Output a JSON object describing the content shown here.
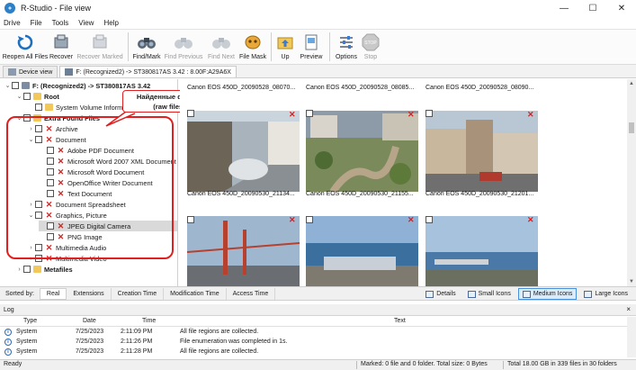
{
  "window": {
    "title": "R-Studio - File view"
  },
  "menu": [
    "Drive",
    "File",
    "Tools",
    "View",
    "Help"
  ],
  "toolbar": {
    "buttons": [
      {
        "label": "Reopen All Files",
        "icon": "reopen-icon",
        "enabled": true
      },
      {
        "label": "Recover",
        "icon": "recover-icon",
        "enabled": true
      },
      {
        "label": "Recover Marked",
        "icon": "recover-marked-icon",
        "enabled": false
      },
      {
        "label": "Find/Mark",
        "icon": "binoculars-icon",
        "enabled": true
      },
      {
        "label": "Find Previous",
        "icon": "find-previous-icon",
        "enabled": false
      },
      {
        "label": "Find Next",
        "icon": "find-next-icon",
        "enabled": false
      },
      {
        "label": "File Mask",
        "icon": "file-mask-icon",
        "enabled": true
      },
      {
        "label": "Up",
        "icon": "folder-up-icon",
        "enabled": true
      },
      {
        "label": "Preview",
        "icon": "preview-icon",
        "enabled": true
      },
      {
        "label": "Options",
        "icon": "options-icon",
        "enabled": true
      },
      {
        "label": "Stop",
        "icon": "stop-icon",
        "enabled": false
      }
    ]
  },
  "tabs": [
    {
      "label": "Device view"
    },
    {
      "label": "F: (Recognized2) -> ST380817AS 3.42 : 8.00F:A29A6X"
    }
  ],
  "tree": {
    "items": [
      {
        "label": "F: (Recognized2) -> ST380817AS 3.42",
        "bold": true,
        "icon": "drive-icon",
        "expander": "v"
      },
      {
        "label": "Root",
        "bold": true,
        "icon": "folder-icon",
        "expander": "v"
      },
      {
        "label": "System Volume Information",
        "bold": false,
        "icon": "folder-icon",
        "expander": ""
      },
      {
        "label": "Extra Found Files",
        "bold": true,
        "icon": "folder-icon",
        "expander": "v"
      },
      {
        "label": "Archive",
        "bold": false,
        "icon": "deleted-icon",
        "expander": ">"
      },
      {
        "label": "Document",
        "bold": false,
        "icon": "deleted-icon",
        "expander": "v"
      },
      {
        "label": "Adobe PDF Document",
        "bold": false,
        "icon": "deleted-icon",
        "expander": ""
      },
      {
        "label": "Microsoft Word 2007 XML Document",
        "bold": false,
        "icon": "deleted-icon",
        "expander": ""
      },
      {
        "label": "Microsoft Word Document",
        "bold": false,
        "icon": "deleted-icon",
        "expander": ""
      },
      {
        "label": "OpenOffice Writer Document",
        "bold": false,
        "icon": "deleted-icon",
        "expander": ""
      },
      {
        "label": "Text Document",
        "bold": false,
        "icon": "deleted-icon",
        "expander": ""
      },
      {
        "label": "Document Spreadsheet",
        "bold": false,
        "icon": "deleted-icon",
        "expander": ">"
      },
      {
        "label": "Graphics, Picture",
        "bold": false,
        "icon": "deleted-icon",
        "expander": "v"
      },
      {
        "label": "JPEG Digital Camera",
        "bold": false,
        "icon": "deleted-icon",
        "expander": ""
      },
      {
        "label": "PNG Image",
        "bold": false,
        "icon": "deleted-icon",
        "expander": ""
      },
      {
        "label": "Multimedia Audio",
        "bold": false,
        "icon": "deleted-icon",
        "expander": ">"
      },
      {
        "label": "Multimedia Video",
        "bold": false,
        "icon": "deleted-icon",
        "expander": ">"
      },
      {
        "label": "Metafiles",
        "bold": true,
        "icon": "folder-icon",
        "expander": ">"
      }
    ]
  },
  "annotation": {
    "line1": "Найденные файлы",
    "line2": "(raw files)"
  },
  "preview": {
    "row1_captions": [
      "Canon EOS 450D_20090528_08070...",
      "Canon EOS 450D_20090528_08085...",
      "Canon EOS 450D_20090528_08090..."
    ],
    "row2_captions": [
      "Canon EOS 450D_20090530_21134...",
      "Canon EOS 450D_20090530_21155...",
      "Canon EOS 450D_20090530_21201..."
    ]
  },
  "sortbar": {
    "label": "Sorted by:",
    "tabs": [
      "Real",
      "Extensions",
      "Creation Time",
      "Modification Time",
      "Access Time"
    ],
    "views": [
      "Details",
      "Small Icons",
      "Medium Icons",
      "Large Icons"
    ]
  },
  "log": {
    "title": "Log",
    "close": "×",
    "columns": {
      "type": "Type",
      "date": "Date",
      "time": "Time",
      "text": "Text"
    },
    "rows": [
      {
        "type": "System",
        "date": "7/25/2023",
        "time": "2:11:09 PM",
        "text": "All file regions are collected."
      },
      {
        "type": "System",
        "date": "7/25/2023",
        "time": "2:11:26 PM",
        "text": "File enumeration was completed in 1s."
      },
      {
        "type": "System",
        "date": "7/25/2023",
        "time": "2:11:28 PM",
        "text": "All file regions are collected."
      }
    ]
  },
  "status": {
    "ready": "Ready",
    "marked": "Marked: 0 file and 0 folder. Total size: 0 Bytes",
    "total": "Total 18.00 GB in 339 files in 30 folders"
  },
  "colors": {
    "annotation": "#e02020",
    "accent": "#2d7fc6",
    "deleted": "#d62020"
  }
}
